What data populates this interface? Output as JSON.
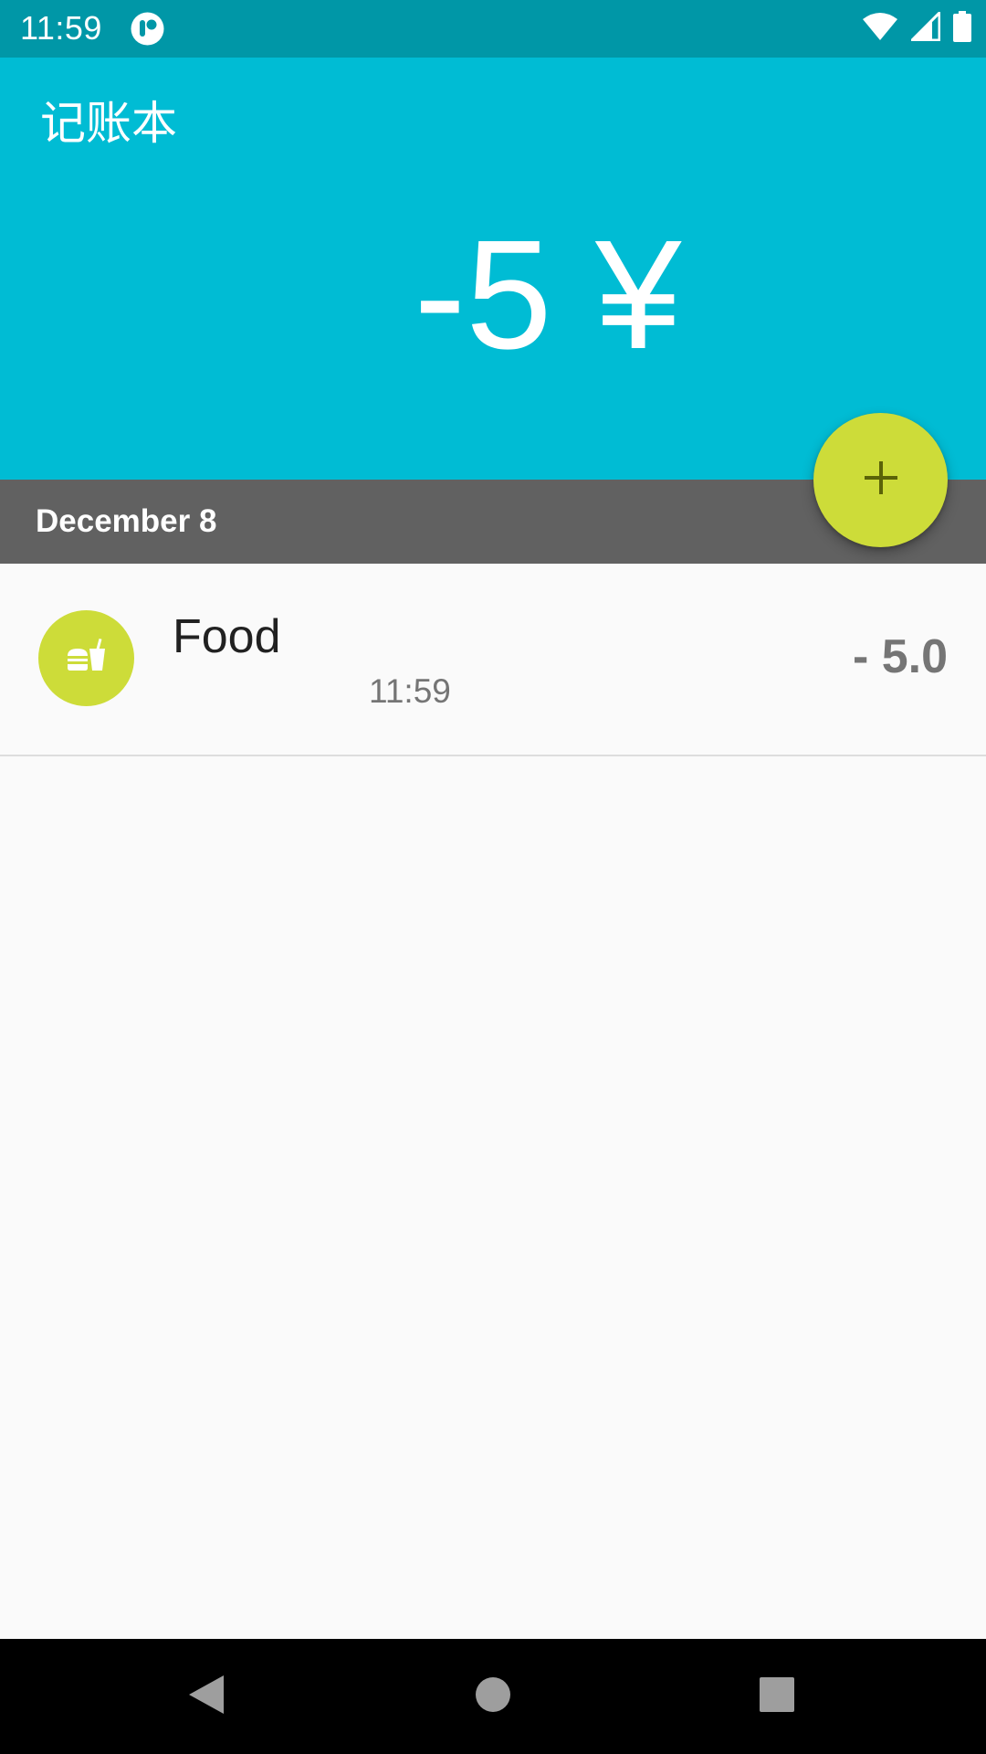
{
  "status_bar": {
    "time": "11:59",
    "icons": [
      "app-notification-icon",
      "wifi-icon",
      "cellular-signal-icon",
      "battery-icon"
    ]
  },
  "header": {
    "app_title": "记账本",
    "balance": "-5 ¥"
  },
  "fab": {
    "label": "+",
    "icon": "add-icon"
  },
  "date_section": {
    "label": "December 8"
  },
  "records": [
    {
      "icon": "fast-food-icon",
      "category": "Food",
      "time": "11:59",
      "amount": "- 5.0"
    }
  ],
  "nav_bar": {
    "icons": [
      "back-icon",
      "home-icon",
      "recents-icon"
    ]
  },
  "colors": {
    "status_bar": "#0097a7",
    "header": "#00bcd4",
    "date_bar": "#616161",
    "accent": "#cddc39",
    "background": "#fafafa"
  }
}
